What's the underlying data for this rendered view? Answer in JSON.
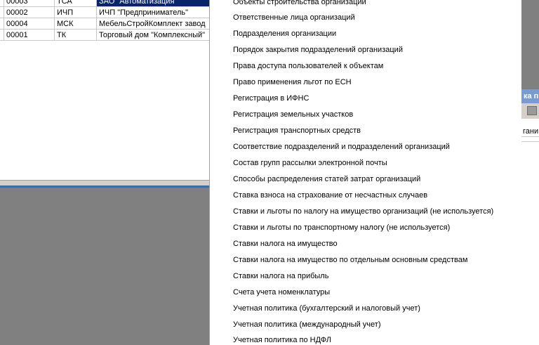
{
  "table": {
    "rows": [
      {
        "code": "00003",
        "prefix": "ТСА",
        "name": "ЗАО \"Автоматизация\"",
        "selected": true
      },
      {
        "code": "00002",
        "prefix": "ИЧП",
        "name": "ИЧП \"Предприниматель\"",
        "selected": false
      },
      {
        "code": "00004",
        "prefix": "МСК",
        "name": "МебельСтройКомплект завод",
        "selected": false
      },
      {
        "code": "00001",
        "prefix": "ТК",
        "name": "Торговый дом \"Комплексный\"",
        "selected": false
      }
    ]
  },
  "background_window": {
    "title": "ка п",
    "column_header": "гани"
  },
  "menu": {
    "items": [
      "Объекты строительства организаций",
      "Ответственные лица организаций",
      "Подразделения организации",
      "Порядок закрытия подразделений организаций",
      "Права доступа пользователей к объектам",
      "Право применения льгот по ЕСН",
      "Регистрация в ИФНС",
      "Регистрация земельных участков",
      "Регистрация транспортных средств",
      "Соответствие подразделений и подразделений организаций",
      "Состав групп рассылки электронной почты",
      "Способы распределения статей затрат организаций",
      "Ставка взноса на страхование от несчастных случаев",
      "Ставки и льготы по налогу на имущество организаций (не используется)",
      "Ставки и льготы по транспортному налогу (не используется)",
      "Ставки налога на имущество",
      "Ставки налога на имущество по отдельным основным средствам",
      "Ставки налога на прибыль",
      "Счета учета номенклатуры",
      "Учетная политика (бухгалтерский и налоговый учет)",
      "Учетная политика (международный учет)",
      "Учетная политика по НДФЛ"
    ]
  }
}
